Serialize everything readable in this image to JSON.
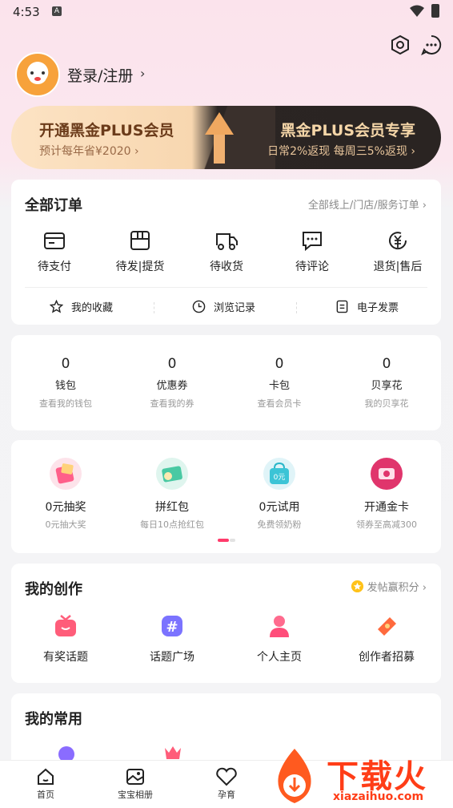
{
  "status": {
    "time": "4:53",
    "badge": "A"
  },
  "header": {
    "login_label": "登录/注册",
    "chevron": "›"
  },
  "plus_banner": {
    "left_title": "开通黑金PLUS会员",
    "left_sub": "预计每年省¥2020 ›",
    "right_title": "黑金PLUS会员专享",
    "right_sub": "日常2%返现 每周三5%返现 ›"
  },
  "orders": {
    "title": "全部订单",
    "link": "全部线上/门店/服务订单 ›",
    "items": [
      {
        "label": "待支付",
        "icon": "wallet-card-icon"
      },
      {
        "label": "待发|提货",
        "icon": "box-icon"
      },
      {
        "label": "待收货",
        "icon": "truck-icon"
      },
      {
        "label": "待评论",
        "icon": "comment-icon"
      },
      {
        "label": "退货|售后",
        "icon": "yen-refund-icon"
      }
    ],
    "quick": [
      {
        "label": "我的收藏",
        "icon": "star-icon"
      },
      {
        "label": "浏览记录",
        "icon": "clock-icon"
      },
      {
        "label": "电子发票",
        "icon": "invoice-icon"
      }
    ]
  },
  "assets": [
    {
      "value": "0",
      "label": "钱包",
      "sub": "查看我的钱包"
    },
    {
      "value": "0",
      "label": "优惠券",
      "sub": "查看我的券"
    },
    {
      "value": "0",
      "label": "卡包",
      "sub": "查看会员卡"
    },
    {
      "value": "0",
      "label": "贝享花",
      "sub": "我的贝享花"
    }
  ],
  "promos": [
    {
      "label": "0元抽奖",
      "sub": "0元抽大奖",
      "icon": "lottery-icon"
    },
    {
      "label": "拼红包",
      "sub": "每日10点抢红包",
      "icon": "red-packet-icon"
    },
    {
      "label": "0元试用",
      "sub": "免费领奶粉",
      "icon": "trial-bag-icon",
      "icon_text": "0元"
    },
    {
      "label": "开通金卡",
      "sub": "领券至高减300",
      "icon": "gold-card-icon"
    }
  ],
  "creation": {
    "title": "我的创作",
    "link": "发帖赢积分 ›",
    "items": [
      {
        "label": "有奖话题",
        "icon": "gift-topic-icon"
      },
      {
        "label": "话题广场",
        "icon": "hashtag-icon"
      },
      {
        "label": "个人主页",
        "icon": "person-icon"
      },
      {
        "label": "创作者招募",
        "icon": "megaphone-icon"
      }
    ]
  },
  "common": {
    "title": "我的常用"
  },
  "tabbar": [
    {
      "label": "首页",
      "icon": "home-icon"
    },
    {
      "label": "宝宝相册",
      "icon": "photo-album-icon"
    },
    {
      "label": "孕育",
      "icon": "heart-hands-icon"
    }
  ],
  "watermark": {
    "title": "下载火",
    "url": "xiazaihuo.com"
  },
  "colors": {
    "accent": "#ff3b6b",
    "gold_text": "#f5d6a8",
    "banner_dark": "#2a2422"
  }
}
